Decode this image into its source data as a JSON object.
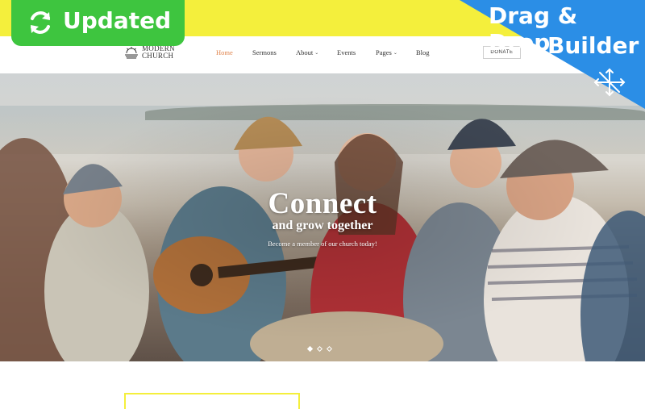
{
  "badge": {
    "label": "Updated"
  },
  "ribbon": {
    "line1": "Drag & Drop",
    "line2": "Builder"
  },
  "logo": {
    "line1": "Modern",
    "line2": "Church"
  },
  "nav": [
    {
      "label": "Home",
      "active": true,
      "dropdown": false
    },
    {
      "label": "Sermons",
      "active": false,
      "dropdown": false
    },
    {
      "label": "About",
      "active": false,
      "dropdown": true
    },
    {
      "label": "Events",
      "active": false,
      "dropdown": false
    },
    {
      "label": "Pages",
      "active": false,
      "dropdown": true
    },
    {
      "label": "Blog",
      "active": false,
      "dropdown": false
    }
  ],
  "donate": {
    "label": "DONATE"
  },
  "hero": {
    "title": "Connect",
    "subtitle": "and grow together",
    "tagline": "Become a member of our church today!",
    "slides": 3,
    "active_slide": 0
  },
  "colors": {
    "accent": "#e0824a",
    "badge_green": "#3ec53f",
    "ribbon_blue": "#2b8ee6",
    "band_yellow": "#f4ef3c"
  },
  "icons": {
    "refresh": "refresh-icon",
    "move_arrows": "move-arrows-icon",
    "chevron": "chevron-down-icon",
    "logo": "church-logo-icon"
  }
}
